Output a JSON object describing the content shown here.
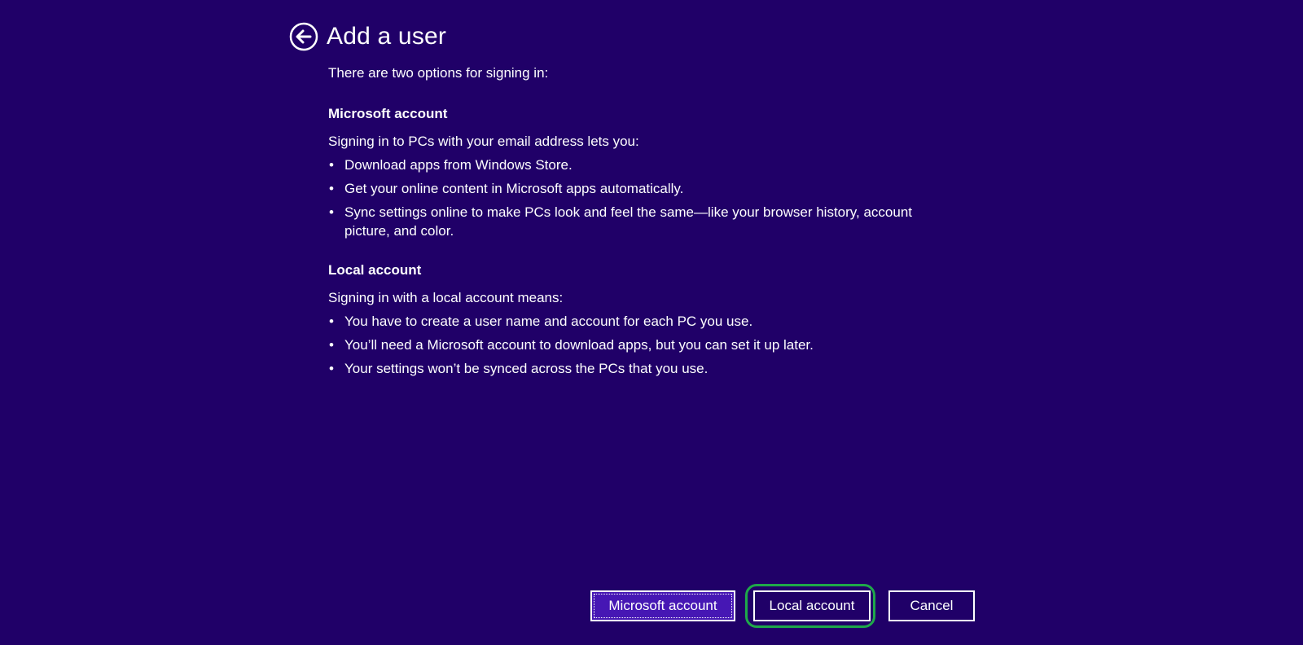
{
  "header": {
    "back_icon": "back-arrow-circle-icon",
    "title": "Add a user"
  },
  "content": {
    "intro": "There are two options for signing in:",
    "microsoft": {
      "heading": "Microsoft account",
      "intro": "Signing in to PCs with your email address lets you:",
      "bullets": [
        "Download apps from Windows Store.",
        "Get your online content in Microsoft apps automatically.",
        "Sync settings online to make PCs look and feel the same—like your browser history, account picture, and color."
      ]
    },
    "local": {
      "heading": "Local account",
      "intro": "Signing in with a local account means:",
      "bullets": [
        "You have to create a user name and account for each PC you use.",
        "You’ll need a Microsoft account to download apps, but you can set it up later.",
        "Your settings won’t be synced across the PCs that you use."
      ]
    }
  },
  "buttons": {
    "microsoft_account": "Microsoft account",
    "local_account": "Local account",
    "cancel": "Cancel"
  },
  "colors": {
    "background": "#200068",
    "focused_button": "#4617b4",
    "highlight_ring": "#1fa84a"
  }
}
